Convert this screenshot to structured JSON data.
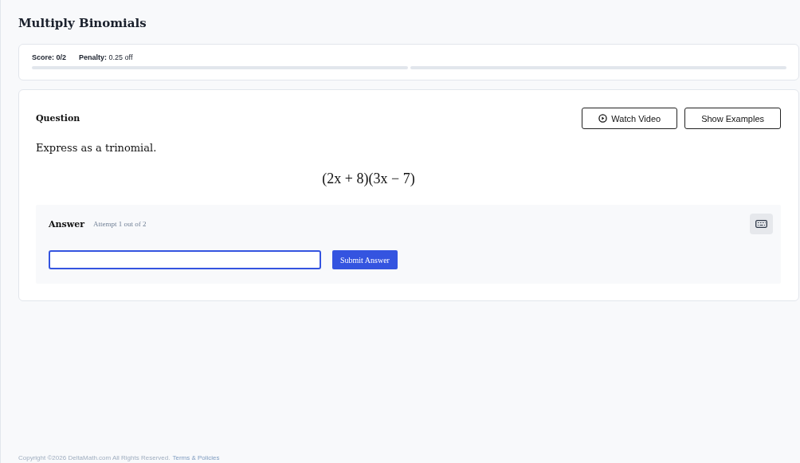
{
  "title": "Multiply Binomials",
  "score": {
    "label": "Score:",
    "value": "0/2",
    "penalty_label": "Penalty:",
    "penalty_value": "0.25 off",
    "segments": [
      {
        "level": 0
      },
      {
        "level": 0
      }
    ]
  },
  "question": {
    "heading": "Question",
    "buttons": [
      {
        "kind": "video",
        "label": "Watch Video"
      },
      {
        "kind": "plain",
        "label": "Show Examples"
      }
    ],
    "prompt": "Express as a trinomial.",
    "expression": "(2x + 8)(3x − 7)"
  },
  "answer": {
    "heading": "Answer",
    "attempt": "Attempt 1 out of 2",
    "submit": "Submit Answer"
  },
  "footer": {
    "copyright": "Copyright ©2026 DeltaMath.com All Rights Reserved.",
    "link": "Terms & Policies"
  }
}
